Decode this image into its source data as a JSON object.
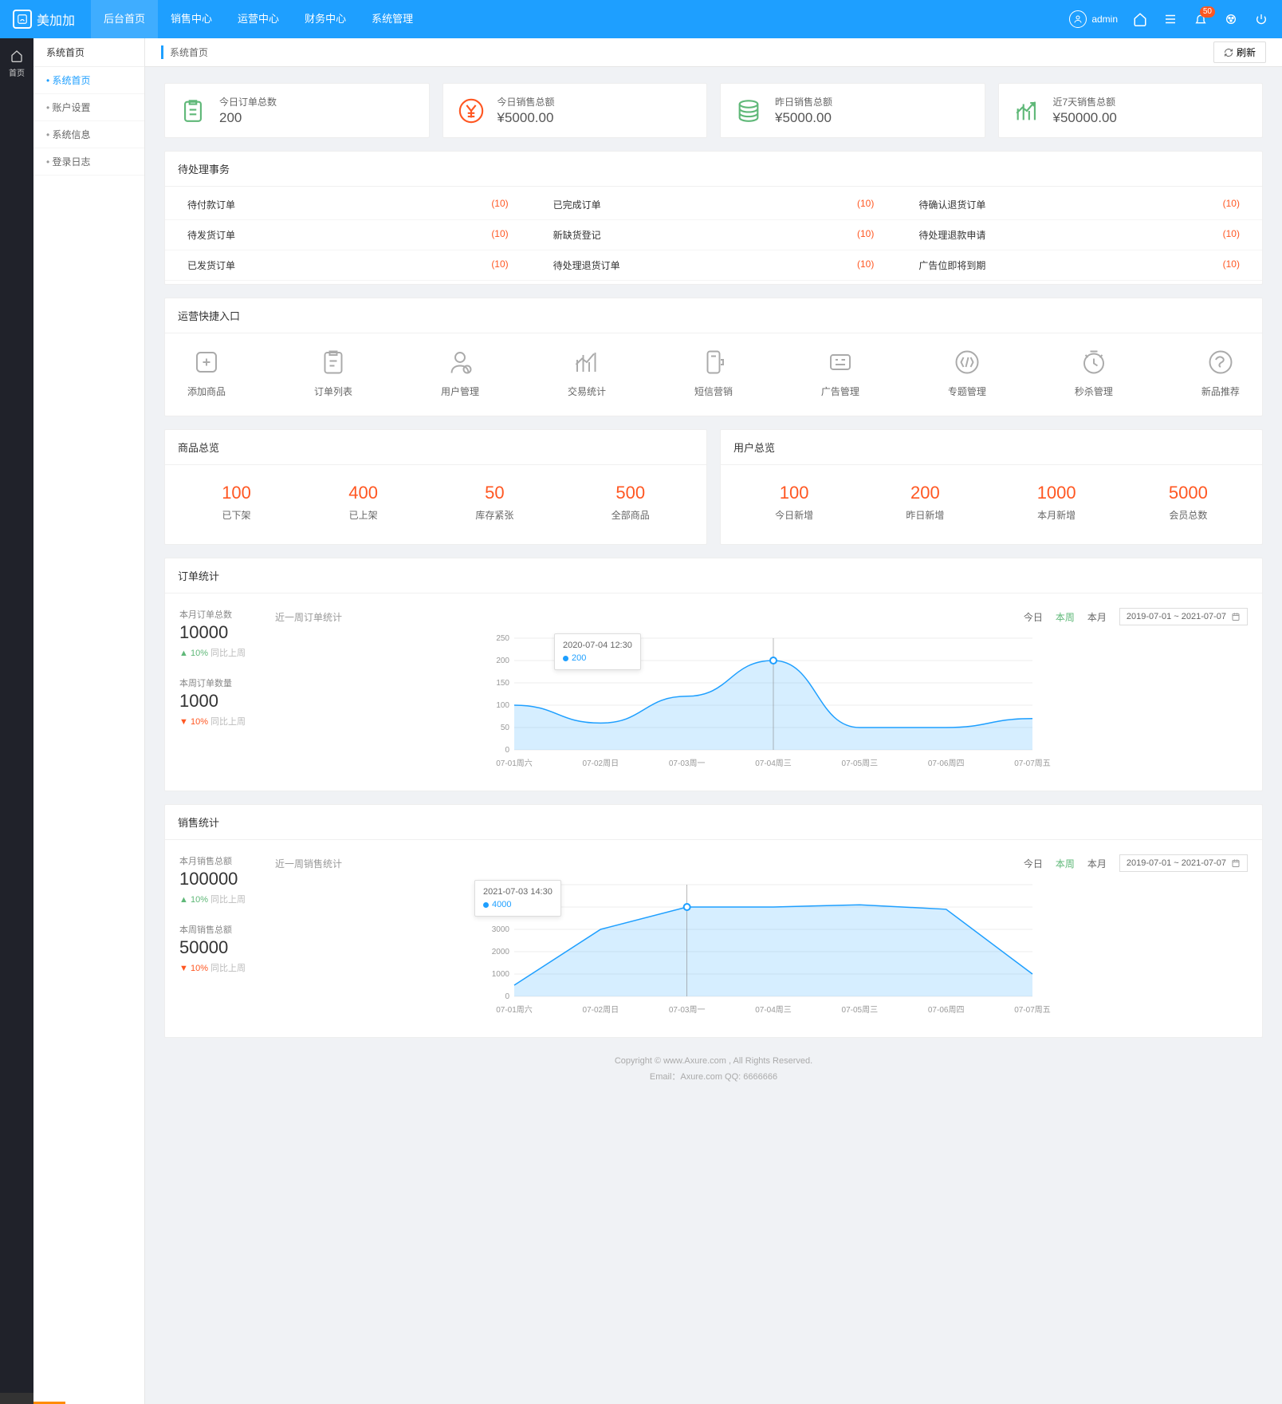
{
  "brand": "美加加",
  "user": "admin",
  "notif_count": "50",
  "topnav": [
    "后台首页",
    "销售中心",
    "运营中心",
    "财务中心",
    "系统管理"
  ],
  "sidebar": {
    "head": "系统首页",
    "items": [
      "系统首页",
      "账户设置",
      "系统信息",
      "登录日志"
    ]
  },
  "crumb": "系统首页",
  "refresh": "刷新",
  "kpi": [
    {
      "label": "今日订单总数",
      "value": "200",
      "color": "#5fb878",
      "icon": "clipboard"
    },
    {
      "label": "今日销售总额",
      "value": "¥5000.00",
      "color": "#ff5722",
      "icon": "yen"
    },
    {
      "label": "昨日销售总额",
      "value": "¥5000.00",
      "color": "#5fb878",
      "icon": "coins"
    },
    {
      "label": "近7天销售总额",
      "value": "¥50000.00",
      "color": "#5fb878",
      "icon": "growth"
    }
  ],
  "todo": {
    "title": "待处理事务",
    "items": [
      {
        "name": "待付款订单",
        "count": "(10)"
      },
      {
        "name": "已完成订单",
        "count": "(10)"
      },
      {
        "name": "待确认退货订单",
        "count": "(10)"
      },
      {
        "name": "待发货订单",
        "count": "(10)"
      },
      {
        "name": "新缺货登记",
        "count": "(10)"
      },
      {
        "name": "待处理退款申请",
        "count": "(10)"
      },
      {
        "name": "已发货订单",
        "count": "(10)"
      },
      {
        "name": "待处理退货订单",
        "count": "(10)"
      },
      {
        "name": "广告位即将到期",
        "count": "(10)"
      }
    ]
  },
  "quick": {
    "title": "运营快捷入口",
    "items": [
      "添加商品",
      "订单列表",
      "用户管理",
      "交易统计",
      "短信营销",
      "广告管理",
      "专题管理",
      "秒杀管理",
      "新品推荐"
    ]
  },
  "overview": {
    "goods": {
      "title": "商品总览",
      "items": [
        {
          "n": "100",
          "l": "已下架"
        },
        {
          "n": "400",
          "l": "已上架"
        },
        {
          "n": "50",
          "l": "库存紧张"
        },
        {
          "n": "500",
          "l": "全部商品"
        }
      ]
    },
    "users": {
      "title": "用户总览",
      "items": [
        {
          "n": "100",
          "l": "今日新增"
        },
        {
          "n": "200",
          "l": "昨日新增"
        },
        {
          "n": "1000",
          "l": "本月新增"
        },
        {
          "n": "5000",
          "l": "会员总数"
        }
      ]
    }
  },
  "order_stat": {
    "title": "订单统计",
    "m_label": "本月订单总数",
    "m_val": "10000",
    "m_delta": "10%",
    "m_cmp": "同比上周",
    "w_label": "本周订单数量",
    "w_val": "1000",
    "w_delta": "10%",
    "w_cmp": "同比上周",
    "chart_title": "近一周订单统计",
    "tabs": {
      "today": "今日",
      "week": "本周",
      "month": "本月"
    },
    "range": "2019-07-01 ~ 2021-07-07",
    "tooltip": {
      "time": "2020-07-04   12:30",
      "val": "200"
    }
  },
  "sales_stat": {
    "title": "销售统计",
    "m_label": "本月销售总额",
    "m_val": "100000",
    "m_delta": "10%",
    "m_cmp": "同比上周",
    "w_label": "本周销售总额",
    "w_val": "50000",
    "w_delta": "10%",
    "w_cmp": "同比上周",
    "chart_title": "近一周销售统计",
    "tabs": {
      "today": "今日",
      "week": "本周",
      "month": "本月"
    },
    "range": "2019-07-01 ~ 2021-07-07",
    "tooltip": {
      "time": "2021-07-03   14:30",
      "val": "4000"
    }
  },
  "chart_data": [
    {
      "type": "area",
      "title": "近一周订单统计",
      "ylabel": "",
      "ylim": [
        0,
        250
      ],
      "categories": [
        "07-01周六",
        "07-02周日",
        "07-03周一",
        "07-04周三",
        "07-05周三",
        "07-06周四",
        "07-07周五"
      ],
      "values": [
        100,
        60,
        120,
        200,
        50,
        50,
        70
      ]
    },
    {
      "type": "area",
      "title": "近一周销售统计",
      "ylabel": "",
      "ylim": [
        0,
        5000
      ],
      "categories": [
        "07-01周六",
        "07-02周日",
        "07-03周一",
        "07-04周三",
        "07-05周三",
        "07-06周四",
        "07-07周五"
      ],
      "values": [
        500,
        3000,
        4000,
        4000,
        4100,
        3900,
        1000
      ]
    }
  ],
  "footer": {
    "l1": "Copyright © www.Axure.com , All Rights Reserved.",
    "l2": "Email：Axure.com     QQ: 6666666"
  }
}
